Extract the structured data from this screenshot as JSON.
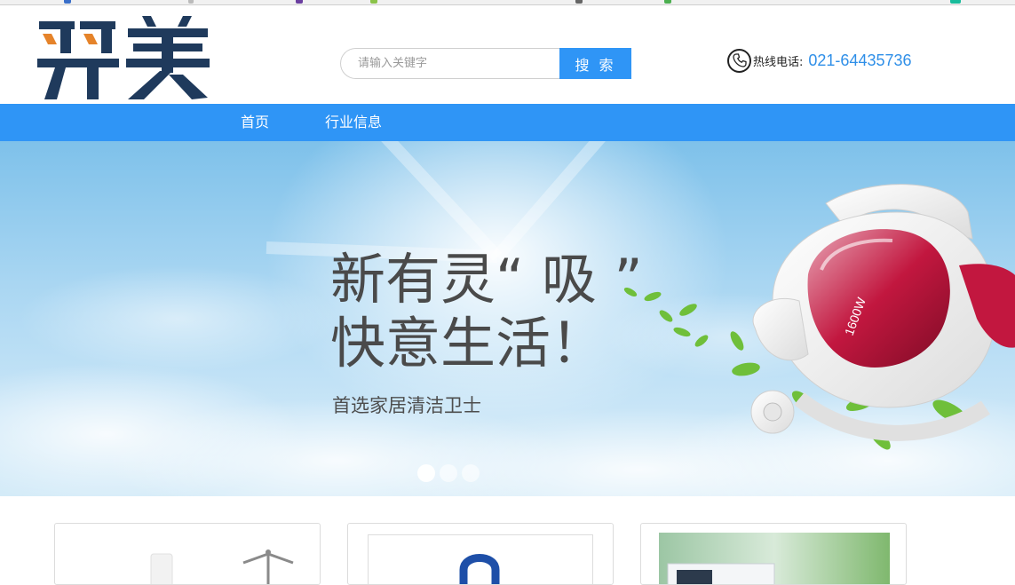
{
  "header": {
    "logo_text": "羿美",
    "search": {
      "placeholder": "请输入关键字",
      "button_label": "搜 索"
    },
    "hotline": {
      "label": "热线电话:",
      "number": "021-64435736"
    }
  },
  "nav": {
    "items": [
      "首页",
      "行业信息"
    ]
  },
  "banner": {
    "title_line1": "新有灵“ 吸 ”",
    "title_line2": "快意生活！",
    "subtitle": "首选家居清洁卫士",
    "vacuum_label": "1600W",
    "slides": 3,
    "active_slide": 1
  },
  "colors": {
    "accent": "#2f95f6",
    "logo_dark": "#1f3a5c",
    "logo_orange": "#e5832a",
    "phone_number": "#2f8fe8"
  },
  "icons": [
    "phone-icon",
    "vacuum-illustration",
    "leaf-decoration"
  ]
}
